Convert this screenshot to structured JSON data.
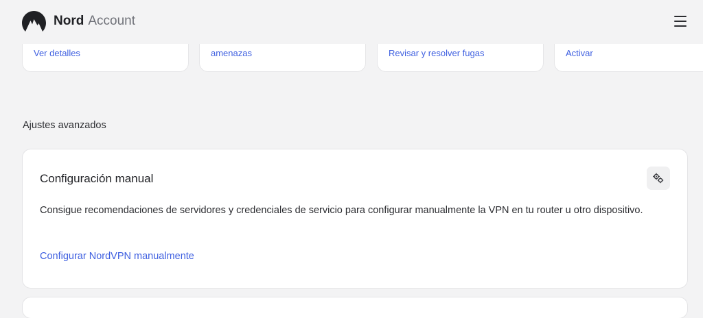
{
  "header": {
    "brand_primary": "Nord",
    "brand_secondary": "Account",
    "menu_icon": "hamburger-menu-icon",
    "logo_icon": "nord-mountain-logo"
  },
  "top_cards": [
    {
      "link": "Ver detalles"
    },
    {
      "link": "amenazas"
    },
    {
      "link": "Revisar y resolver fugas"
    },
    {
      "link": "Activar"
    }
  ],
  "advanced": {
    "section_title": "Ajustes avanzados",
    "card": {
      "title": "Configuración manual",
      "icon": "settings-gears-icon",
      "description": "Consigue recomendaciones de servidores y credenciales de servicio para configurar manualmente la VPN en tu router u otro dispositivo.",
      "link": "Configurar NordVPN manualmente"
    }
  },
  "colors": {
    "background": "#f3f3f4",
    "link": "#3e5fe0",
    "card": "#ffffff"
  }
}
